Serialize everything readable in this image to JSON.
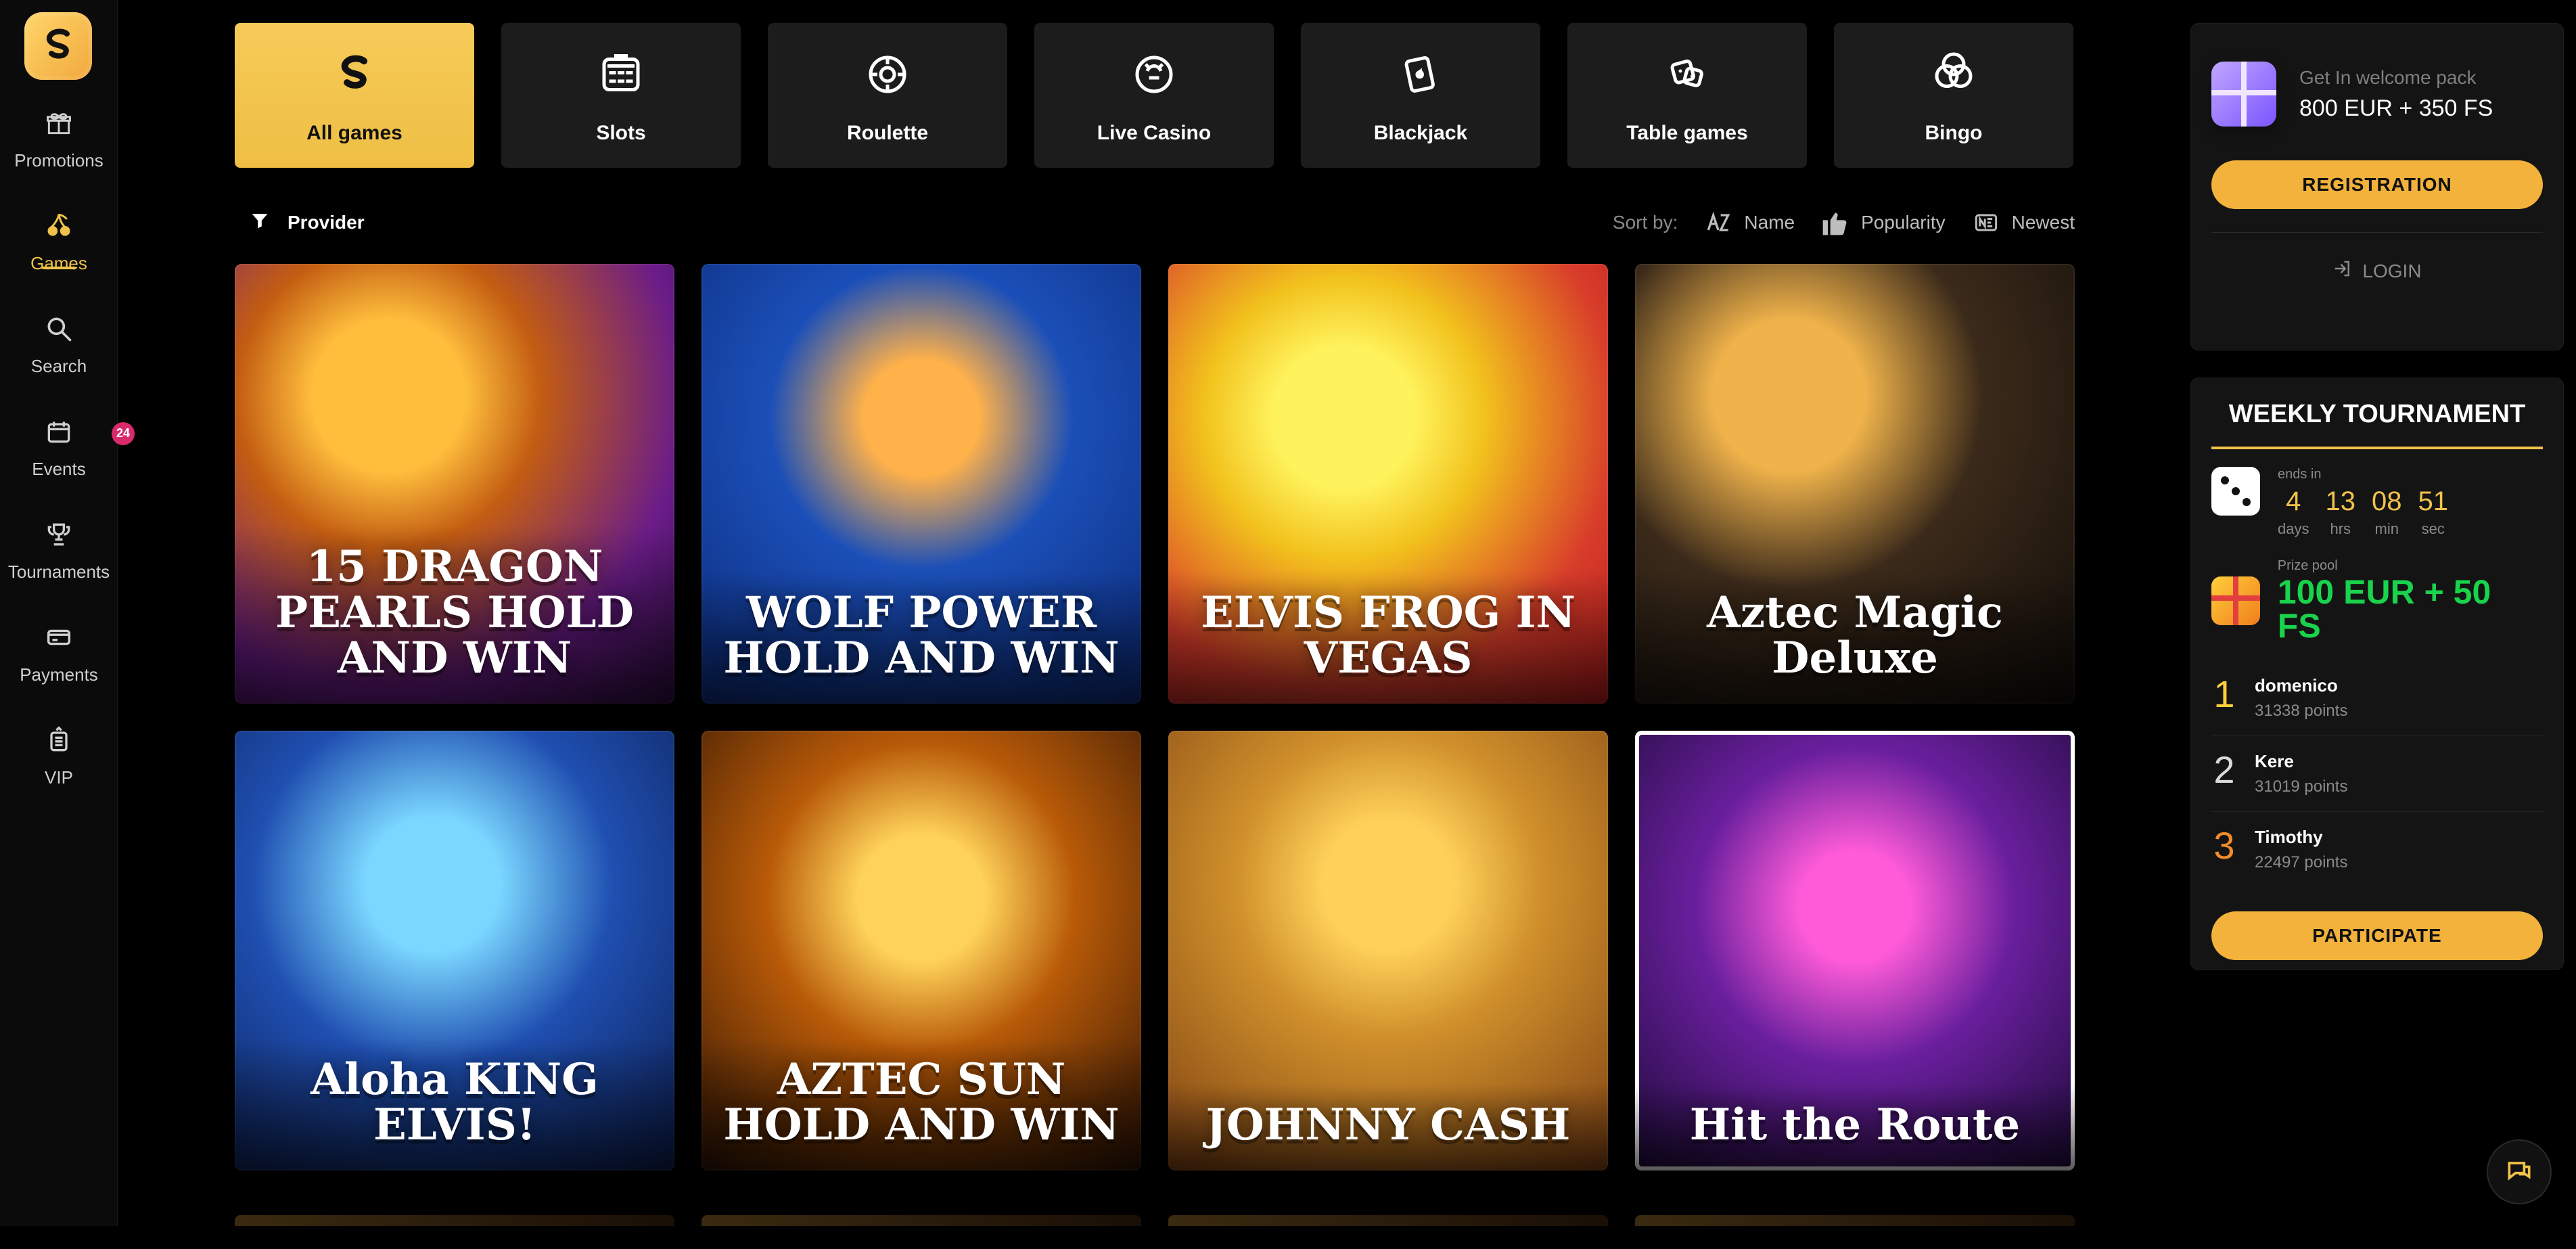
{
  "sidebar": {
    "items": [
      {
        "label": "Promotions",
        "icon": "gift-icon"
      },
      {
        "label": "Games",
        "icon": "cherries-icon",
        "active": true
      },
      {
        "label": "Search",
        "icon": "search-icon"
      },
      {
        "label": "Events",
        "icon": "calendar-icon",
        "badge": "24"
      },
      {
        "label": "Tournaments",
        "icon": "trophy-icon"
      },
      {
        "label": "Payments",
        "icon": "card-icon"
      },
      {
        "label": "VIP",
        "icon": "vip-icon"
      }
    ]
  },
  "categories": [
    {
      "label": "All games",
      "icon": "s-logo-icon",
      "active": true
    },
    {
      "label": "Slots",
      "icon": "slots-icon"
    },
    {
      "label": "Roulette",
      "icon": "roulette-icon"
    },
    {
      "label": "Live Casino",
      "icon": "live-casino-icon"
    },
    {
      "label": "Blackjack",
      "icon": "blackjack-icon"
    },
    {
      "label": "Table games",
      "icon": "table-games-icon"
    },
    {
      "label": "Bingo",
      "icon": "bingo-icon"
    }
  ],
  "filters": {
    "provider_label": "Provider",
    "sort_label": "Sort by:",
    "sort_items": [
      {
        "label": "Name",
        "icon": "az-icon"
      },
      {
        "label": "Popularity",
        "icon": "thumbs-up-icon"
      },
      {
        "label": "Newest",
        "icon": "new-icon"
      }
    ]
  },
  "games": [
    {
      "title": "15 DRAGON PEARLS HOLD AND WIN",
      "class": "g1"
    },
    {
      "title": "WOLF POWER HOLD AND WIN",
      "class": "g2"
    },
    {
      "title": "ELVIS FROG IN VEGAS",
      "class": "g3"
    },
    {
      "title": "Aztec Magic Deluxe",
      "class": "g4"
    },
    {
      "title": "Aloha KING ELVIS!",
      "class": "g5"
    },
    {
      "title": "AZTEC SUN HOLD AND WIN",
      "class": "g6"
    },
    {
      "title": "JOHNNY CASH",
      "class": "g7"
    },
    {
      "title": "Hit the Route",
      "class": "g8"
    }
  ],
  "welcome": {
    "small": "Get In welcome pack",
    "big": "800 EUR + 350 FS",
    "register": "REGISTRATION",
    "login": "LOGIN"
  },
  "tournament": {
    "title": "WEEKLY TOURNAMENT",
    "ends_in": "ends in",
    "timer": [
      {
        "n": "4",
        "u": "days"
      },
      {
        "n": "13",
        "u": "hrs"
      },
      {
        "n": "08",
        "u": "min"
      },
      {
        "n": "51",
        "u": "sec"
      }
    ],
    "prize_label": "Prize pool",
    "prize_value": "100 EUR + 50 FS",
    "leaders": [
      {
        "rank": "1",
        "name": "domenico",
        "points": "31338 points"
      },
      {
        "rank": "2",
        "name": "Kere",
        "points": "31019 points"
      },
      {
        "rank": "3",
        "name": "Timothy",
        "points": "22497 points"
      }
    ],
    "participate": "PARTICIPATE"
  },
  "colors": {
    "accent": "#f0c24a",
    "button": "#f2b23b",
    "prize_green": "#18d34b"
  }
}
